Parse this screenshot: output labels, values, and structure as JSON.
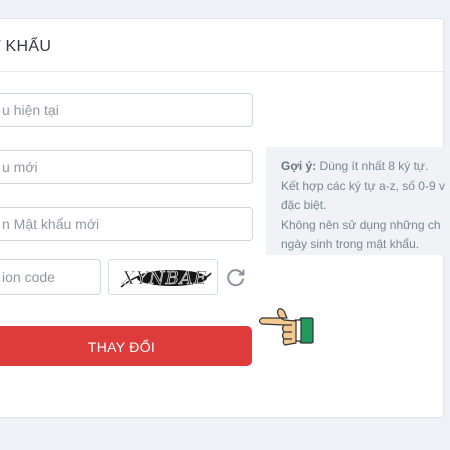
{
  "card": {
    "title": "T KHẨU"
  },
  "form": {
    "current_password_placeholder": "u hiện tại",
    "new_password_placeholder": "u mới",
    "confirm_password_placeholder": "n Mật khẩu mới",
    "captcha_code_placeholder": "ion code",
    "captcha_text": "XYNBAE",
    "submit_label": "THAY ĐỔI"
  },
  "hint": {
    "label": "Gợi ý:",
    "line1": " Dùng ít nhất 8 ký tự.",
    "line2": "Kết hợp các ký tự a-z, số 0-9 v",
    "line3": "đặc biệt.",
    "line4": "Không nên sử dụng những ch",
    "line5": "ngày sinh trong mật khẩu."
  },
  "icons": {
    "refresh": "refresh-icon",
    "pointing_hand": "pointing-hand-icon"
  },
  "colors": {
    "submit_bg": "#de3b3b",
    "cuff": "#1f9a5a",
    "skin": "#f4c98e"
  }
}
